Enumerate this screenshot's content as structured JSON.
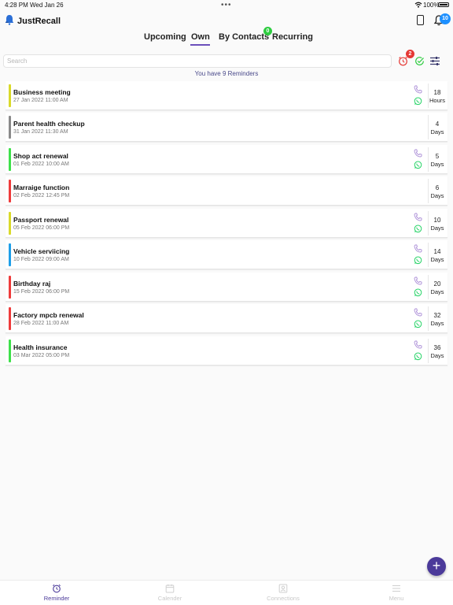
{
  "status_bar": {
    "time": "4:28 PM",
    "date": "Wed Jan 26",
    "battery": "100%"
  },
  "app": {
    "title": "JustRecall",
    "notification_count": "10"
  },
  "tabs": [
    {
      "label": "Upcoming",
      "active": false
    },
    {
      "label": "Own",
      "active": true
    },
    {
      "label": "By Contacts",
      "active": false,
      "badge": "0"
    },
    {
      "label": "Recurring",
      "active": false
    }
  ],
  "search": {
    "placeholder": "Search",
    "value": ""
  },
  "toolbar": {
    "alarm_badge": "2"
  },
  "summary": "You have 9 Reminders",
  "colors": {
    "accent": "#6b4fbb",
    "fab": "#4b3a9a",
    "badge_blue": "#1e90ff",
    "badge_red": "#e53935",
    "whatsapp": "#25d366",
    "call": "#a98bd6"
  },
  "reminders": [
    {
      "title": "Business meeting",
      "date": "27 Jan 2022 11:00 AM",
      "count": "18",
      "unit": "Hours",
      "color": "#d9d92a",
      "has_contact_actions": true
    },
    {
      "title": "Parent health checkup",
      "date": "31 Jan 2022 11:30 AM",
      "count": "4",
      "unit": "Days",
      "color": "#8a8a8a",
      "has_contact_actions": false
    },
    {
      "title": "Shop act renewal",
      "date": "01 Feb 2022 10:00 AM",
      "count": "5",
      "unit": "Days",
      "color": "#3ee04a",
      "has_contact_actions": true
    },
    {
      "title": "Marraige function",
      "date": "02 Feb 2022 12:45 PM",
      "count": "6",
      "unit": "Days",
      "color": "#ee3b3b",
      "has_contact_actions": false
    },
    {
      "title": "Passport renewal",
      "date": "05 Feb 2022 06:00 PM",
      "count": "10",
      "unit": "Days",
      "color": "#d9d92a",
      "has_contact_actions": true
    },
    {
      "title": "Vehicle serviicing",
      "date": "10 Feb 2022 09:00 AM",
      "count": "14",
      "unit": "Days",
      "color": "#1e9fe8",
      "has_contact_actions": true
    },
    {
      "title": "Birthday raj",
      "date": "15 Feb 2022 06:00 PM",
      "count": "20",
      "unit": "Days",
      "color": "#ee3b3b",
      "has_contact_actions": true
    },
    {
      "title": "Factory mpcb renewal",
      "date": "28 Feb 2022 11:00 AM",
      "count": "32",
      "unit": "Days",
      "color": "#ee3b3b",
      "has_contact_actions": true
    },
    {
      "title": "Health insurance",
      "date": "03 Mar 2022 05:00 PM",
      "count": "36",
      "unit": "Days",
      "color": "#3ee04a",
      "has_contact_actions": true
    }
  ],
  "bottom_nav": [
    {
      "label": "Reminder",
      "icon": "alarm-clock-icon",
      "active": true
    },
    {
      "label": "Calender",
      "icon": "calendar-icon",
      "active": false
    },
    {
      "label": "Connections",
      "icon": "contacts-icon",
      "active": false
    },
    {
      "label": "Menu",
      "icon": "menu-icon",
      "active": false
    }
  ]
}
